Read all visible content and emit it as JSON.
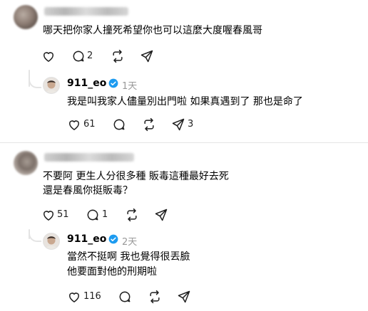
{
  "thread1": {
    "comment": {
      "text": "哪天把你家人撞死希望你也可以這麼大度喔春風哥",
      "reply_count": "2"
    },
    "reply": {
      "username": "911_eo",
      "time": "1天",
      "text": "我是叫我家人儘量別出門啦 如果真遇到了 那也是命了",
      "like_count": "61",
      "share_count": "3"
    }
  },
  "thread2": {
    "comment": {
      "line1": "不要阿 更生人分很多種 販毒這種最好去死",
      "line2": "還是春風你挺販毒？",
      "like_count": "51",
      "reply_count": "1"
    },
    "reply": {
      "username": "911_eo",
      "time": "2天",
      "line1": "當然不挺啊 我也覺得很丟臉",
      "line2": "他要面對他的刑期啦",
      "like_count": "116"
    }
  },
  "colors": {
    "verified": "#1d9bf0",
    "muted": "#999999",
    "icon": "#1f1f1f"
  }
}
